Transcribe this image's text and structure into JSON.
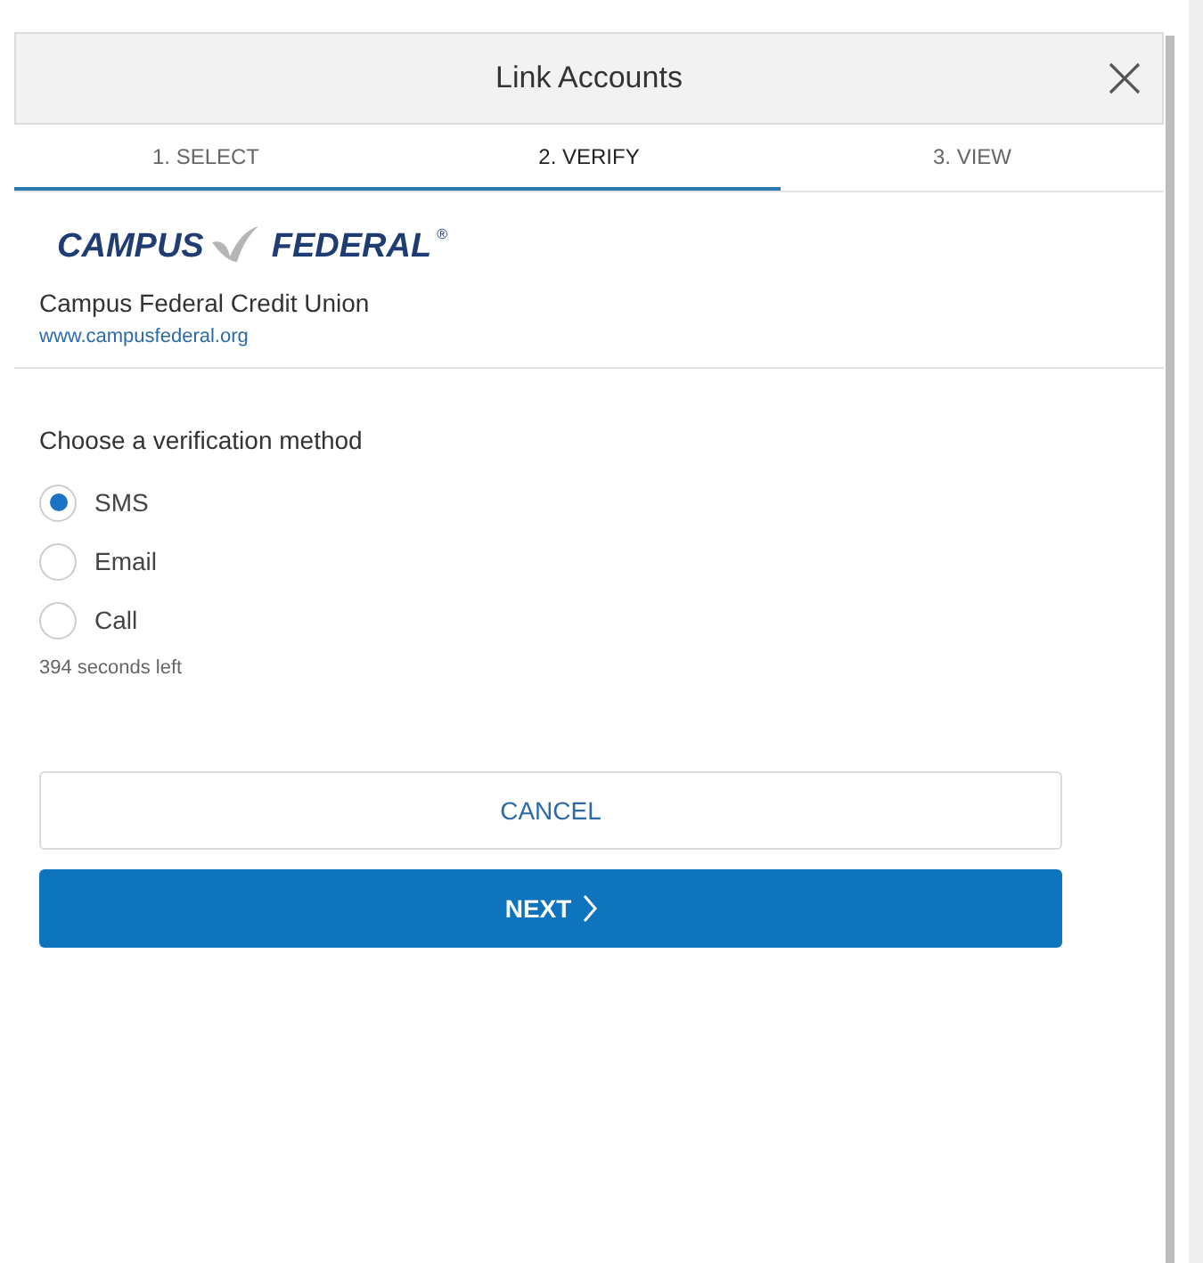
{
  "dialog": {
    "title": "Link Accounts"
  },
  "steps": [
    {
      "label": "1. SELECT",
      "selected": false,
      "completed": true
    },
    {
      "label": "2. VERIFY",
      "selected": true,
      "completed": true
    },
    {
      "label": "3. VIEW",
      "selected": false,
      "completed": false
    }
  ],
  "institution": {
    "logo": {
      "left": "CAMPUS",
      "right": "FEDERAL",
      "mark": "®"
    },
    "name": "Campus Federal Credit Union",
    "url": "www.campusfederal.org"
  },
  "verification": {
    "heading": "Choose a verification method",
    "options": [
      {
        "label": "SMS",
        "selected": true
      },
      {
        "label": "Email",
        "selected": false
      },
      {
        "label": "Call",
        "selected": false
      }
    ],
    "timer": "394 seconds left"
  },
  "buttons": {
    "cancel": "CANCEL",
    "next": "NEXT"
  }
}
